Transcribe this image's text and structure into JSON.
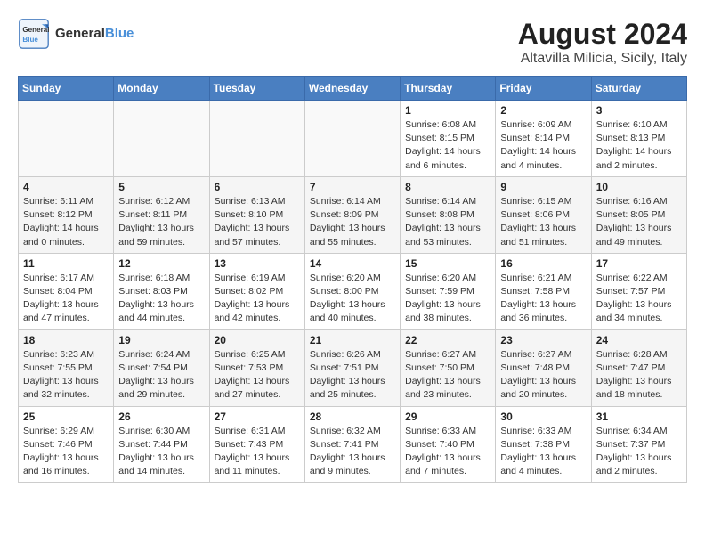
{
  "logo": {
    "line1": "General",
    "line2": "Blue"
  },
  "title": "August 2024",
  "subtitle": "Altavilla Milicia, Sicily, Italy",
  "days_of_week": [
    "Sunday",
    "Monday",
    "Tuesday",
    "Wednesday",
    "Thursday",
    "Friday",
    "Saturday"
  ],
  "weeks": [
    [
      {
        "day": "",
        "info": ""
      },
      {
        "day": "",
        "info": ""
      },
      {
        "day": "",
        "info": ""
      },
      {
        "day": "",
        "info": ""
      },
      {
        "day": "1",
        "info": "Sunrise: 6:08 AM\nSunset: 8:15 PM\nDaylight: 14 hours\nand 6 minutes."
      },
      {
        "day": "2",
        "info": "Sunrise: 6:09 AM\nSunset: 8:14 PM\nDaylight: 14 hours\nand 4 minutes."
      },
      {
        "day": "3",
        "info": "Sunrise: 6:10 AM\nSunset: 8:13 PM\nDaylight: 14 hours\nand 2 minutes."
      }
    ],
    [
      {
        "day": "4",
        "info": "Sunrise: 6:11 AM\nSunset: 8:12 PM\nDaylight: 14 hours\nand 0 minutes."
      },
      {
        "day": "5",
        "info": "Sunrise: 6:12 AM\nSunset: 8:11 PM\nDaylight: 13 hours\nand 59 minutes."
      },
      {
        "day": "6",
        "info": "Sunrise: 6:13 AM\nSunset: 8:10 PM\nDaylight: 13 hours\nand 57 minutes."
      },
      {
        "day": "7",
        "info": "Sunrise: 6:14 AM\nSunset: 8:09 PM\nDaylight: 13 hours\nand 55 minutes."
      },
      {
        "day": "8",
        "info": "Sunrise: 6:14 AM\nSunset: 8:08 PM\nDaylight: 13 hours\nand 53 minutes."
      },
      {
        "day": "9",
        "info": "Sunrise: 6:15 AM\nSunset: 8:06 PM\nDaylight: 13 hours\nand 51 minutes."
      },
      {
        "day": "10",
        "info": "Sunrise: 6:16 AM\nSunset: 8:05 PM\nDaylight: 13 hours\nand 49 minutes."
      }
    ],
    [
      {
        "day": "11",
        "info": "Sunrise: 6:17 AM\nSunset: 8:04 PM\nDaylight: 13 hours\nand 47 minutes."
      },
      {
        "day": "12",
        "info": "Sunrise: 6:18 AM\nSunset: 8:03 PM\nDaylight: 13 hours\nand 44 minutes."
      },
      {
        "day": "13",
        "info": "Sunrise: 6:19 AM\nSunset: 8:02 PM\nDaylight: 13 hours\nand 42 minutes."
      },
      {
        "day": "14",
        "info": "Sunrise: 6:20 AM\nSunset: 8:00 PM\nDaylight: 13 hours\nand 40 minutes."
      },
      {
        "day": "15",
        "info": "Sunrise: 6:20 AM\nSunset: 7:59 PM\nDaylight: 13 hours\nand 38 minutes."
      },
      {
        "day": "16",
        "info": "Sunrise: 6:21 AM\nSunset: 7:58 PM\nDaylight: 13 hours\nand 36 minutes."
      },
      {
        "day": "17",
        "info": "Sunrise: 6:22 AM\nSunset: 7:57 PM\nDaylight: 13 hours\nand 34 minutes."
      }
    ],
    [
      {
        "day": "18",
        "info": "Sunrise: 6:23 AM\nSunset: 7:55 PM\nDaylight: 13 hours\nand 32 minutes."
      },
      {
        "day": "19",
        "info": "Sunrise: 6:24 AM\nSunset: 7:54 PM\nDaylight: 13 hours\nand 29 minutes."
      },
      {
        "day": "20",
        "info": "Sunrise: 6:25 AM\nSunset: 7:53 PM\nDaylight: 13 hours\nand 27 minutes."
      },
      {
        "day": "21",
        "info": "Sunrise: 6:26 AM\nSunset: 7:51 PM\nDaylight: 13 hours\nand 25 minutes."
      },
      {
        "day": "22",
        "info": "Sunrise: 6:27 AM\nSunset: 7:50 PM\nDaylight: 13 hours\nand 23 minutes."
      },
      {
        "day": "23",
        "info": "Sunrise: 6:27 AM\nSunset: 7:48 PM\nDaylight: 13 hours\nand 20 minutes."
      },
      {
        "day": "24",
        "info": "Sunrise: 6:28 AM\nSunset: 7:47 PM\nDaylight: 13 hours\nand 18 minutes."
      }
    ],
    [
      {
        "day": "25",
        "info": "Sunrise: 6:29 AM\nSunset: 7:46 PM\nDaylight: 13 hours\nand 16 minutes."
      },
      {
        "day": "26",
        "info": "Sunrise: 6:30 AM\nSunset: 7:44 PM\nDaylight: 13 hours\nand 14 minutes."
      },
      {
        "day": "27",
        "info": "Sunrise: 6:31 AM\nSunset: 7:43 PM\nDaylight: 13 hours\nand 11 minutes."
      },
      {
        "day": "28",
        "info": "Sunrise: 6:32 AM\nSunset: 7:41 PM\nDaylight: 13 hours\nand 9 minutes."
      },
      {
        "day": "29",
        "info": "Sunrise: 6:33 AM\nSunset: 7:40 PM\nDaylight: 13 hours\nand 7 minutes."
      },
      {
        "day": "30",
        "info": "Sunrise: 6:33 AM\nSunset: 7:38 PM\nDaylight: 13 hours\nand 4 minutes."
      },
      {
        "day": "31",
        "info": "Sunrise: 6:34 AM\nSunset: 7:37 PM\nDaylight: 13 hours\nand 2 minutes."
      }
    ]
  ]
}
